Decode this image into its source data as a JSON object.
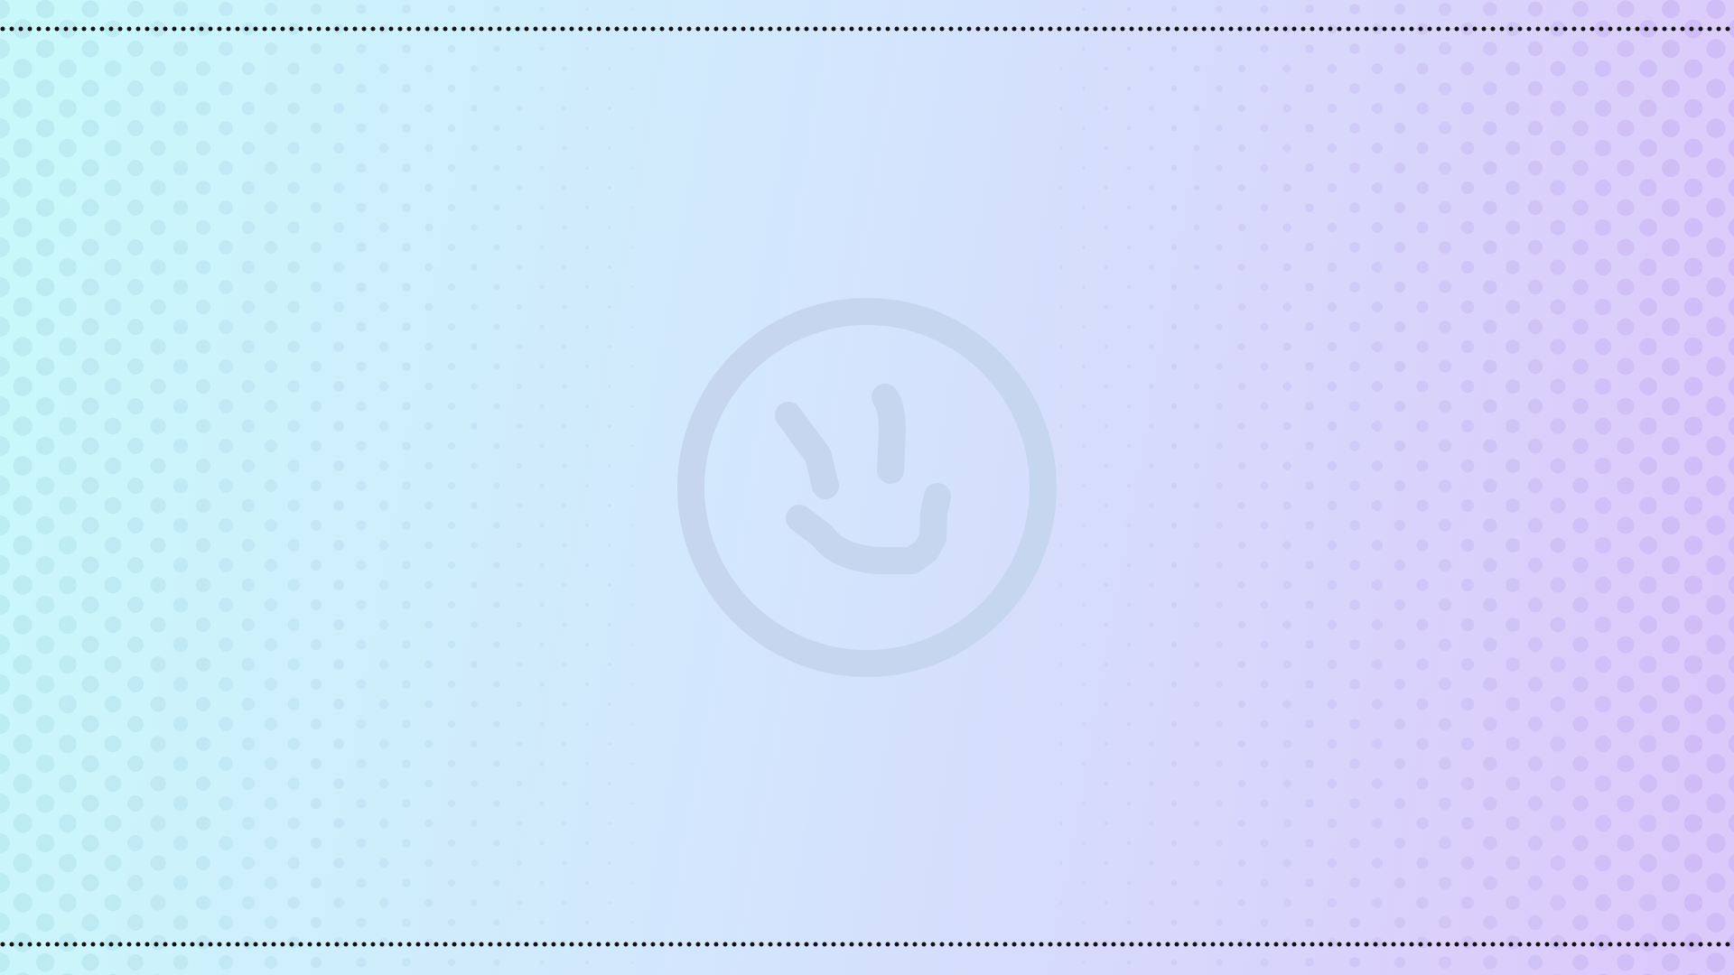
{
  "wallpaper": {
    "gradient_start": "#c9f8fb",
    "gradient_mid": "#d3e6fd",
    "gradient_end": "#dcc9fb",
    "dot_color_left": "#b7e9ef",
    "dot_color_right": "#ccb6f4",
    "border_dot_color": "#111111"
  },
  "logo": {
    "icon": "smiley-face-icon",
    "color": "#c6d6ee"
  }
}
